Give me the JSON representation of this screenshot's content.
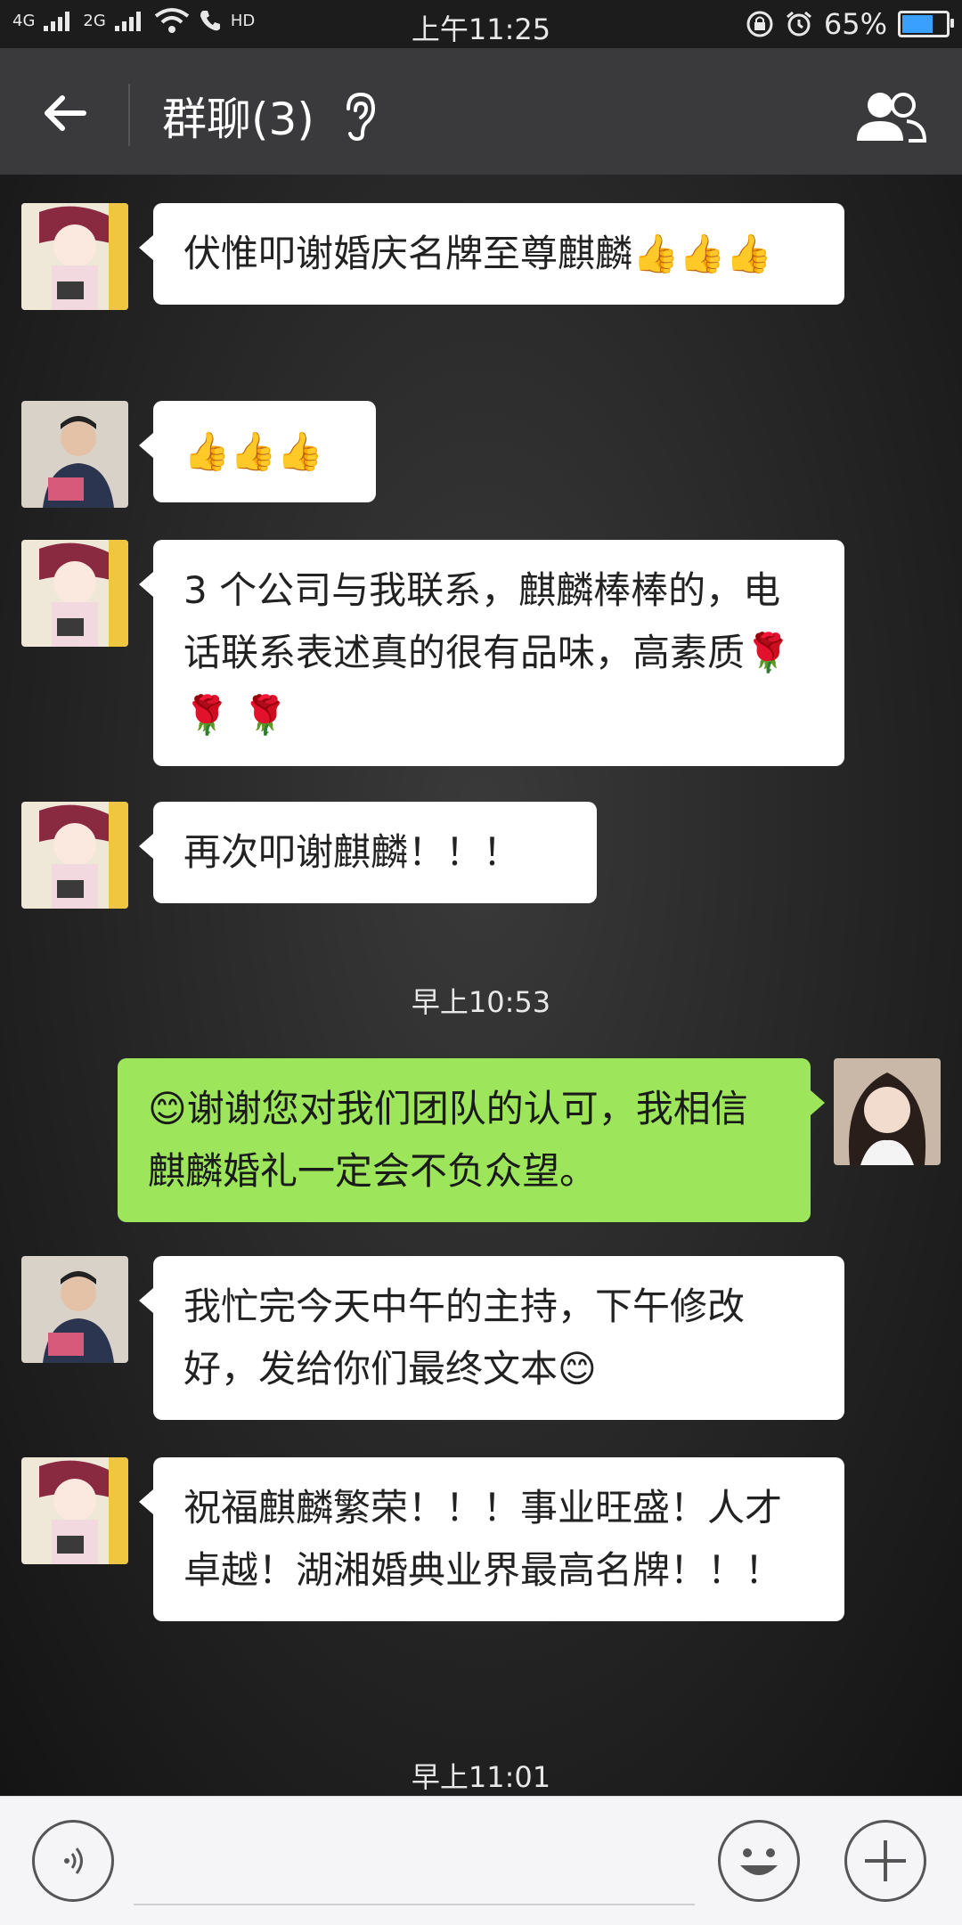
{
  "status_bar": {
    "signal_left": "4G",
    "signal_right": "2G",
    "network_tag": "HD",
    "time": "上午11:25",
    "battery": "65%",
    "battery_level": 0.65,
    "icons": [
      "signal-icon",
      "wifi-icon",
      "call-icon",
      "lock-rotation-icon",
      "alarm-icon",
      "battery-icon"
    ]
  },
  "header": {
    "title": "群聊(3)",
    "back_icon": "back-arrow-icon",
    "earpiece_icon": "earpiece-icon",
    "group_icon": "group-members-icon"
  },
  "messages": [
    {
      "side": "left",
      "avatar": "cartoon-girl",
      "text": "伏惟叩谢婚庆名牌至尊麒麟👍👍👍"
    },
    {
      "side": "left",
      "avatar": "man-reading",
      "text": "👍👍👍"
    },
    {
      "side": "left",
      "avatar": "cartoon-girl",
      "text": "3 个公司与我联系，麒麟棒棒的，电话联系表述真的很有品味，高素质🌹 🌹 🌹"
    },
    {
      "side": "left",
      "avatar": "cartoon-girl",
      "text": "再次叩谢麒麟！！！"
    },
    {
      "type": "time",
      "text": "早上10:53"
    },
    {
      "side": "right",
      "avatar": "young-woman",
      "text": "😊谢谢您对我们团队的认可，我相信麒麟婚礼一定会不负众望。"
    },
    {
      "side": "left",
      "avatar": "man-reading",
      "text": "我忙完今天中午的主持，下午修改好，发给你们最终文本😊"
    },
    {
      "side": "left",
      "avatar": "cartoon-girl",
      "text": "祝福麒麟繁荣！！！事业旺盛！人才卓越！湖湘婚典业界最高名牌！！！"
    },
    {
      "type": "time",
      "text": "早上11:01"
    }
  ],
  "input_bar": {
    "voice_icon": "voice-input-icon",
    "emoji_icon": "emoji-icon",
    "plus_icon": "plus-icon"
  }
}
